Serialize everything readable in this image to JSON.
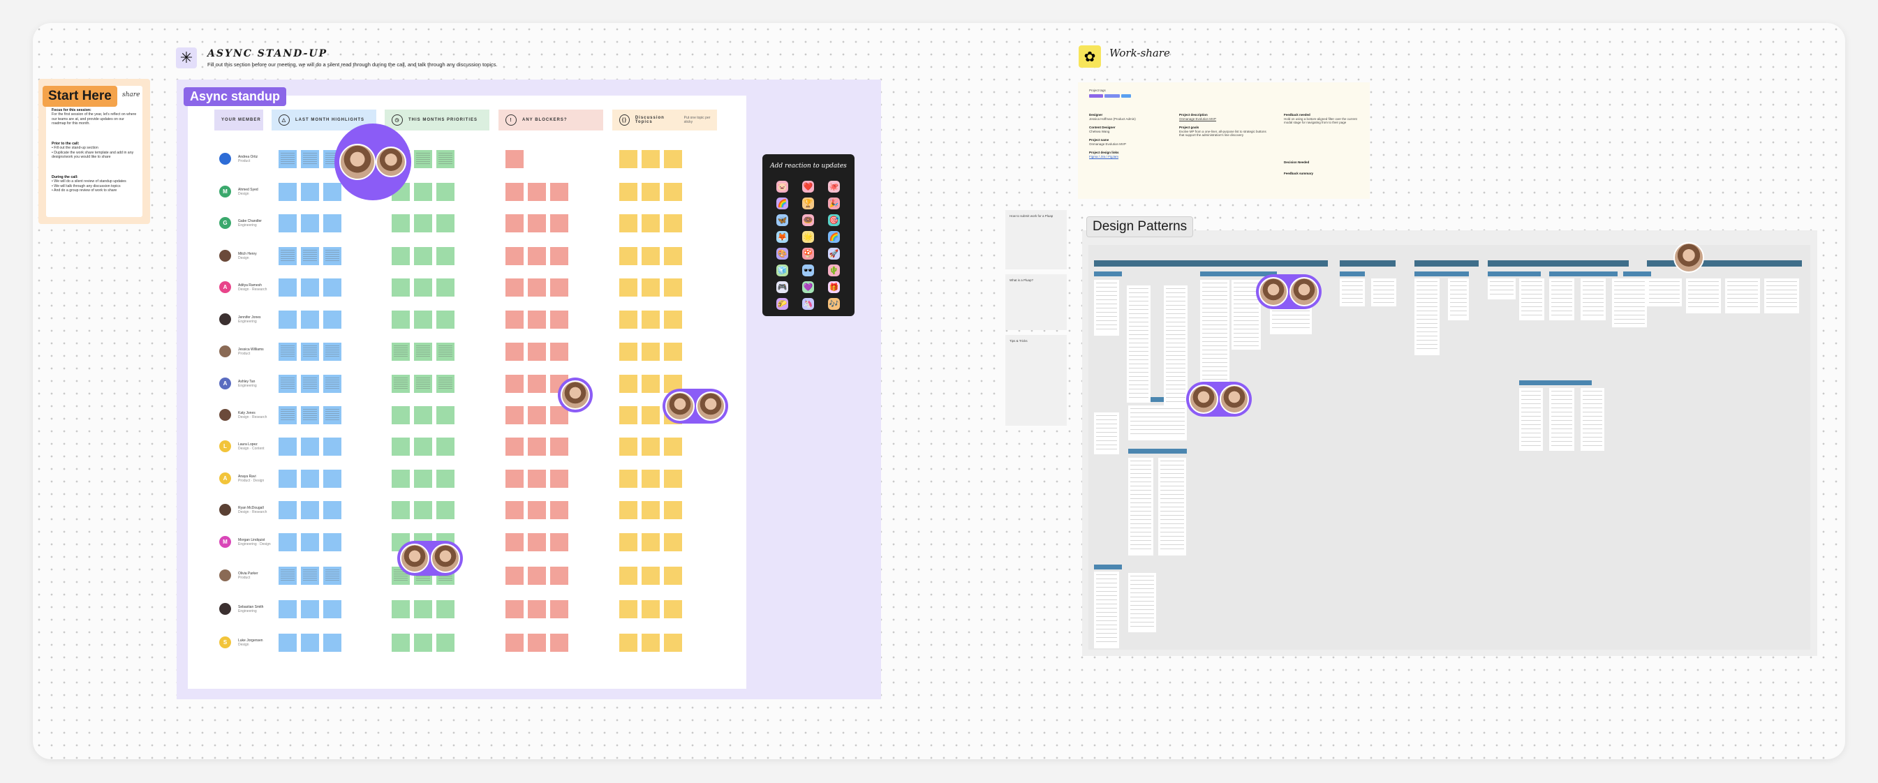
{
  "start_here": {
    "label": "Start Here",
    "share": "share",
    "focus_heading": "Focus for this session:",
    "focus_text": "For the first session of the year, let's reflect on where our teams are at, and provide updates on our roadmap for this month.",
    "prior_heading": "Prior to the call:",
    "prior_items": [
      "Fill out the stand-up section",
      "Duplicate the work share template and add in any designs/work you would like to share"
    ],
    "during_heading": "During the call:",
    "during_items": [
      "We will do a silent review of standup updates",
      "We will talk through any discussion topics",
      "And do a group review of work to share"
    ]
  },
  "async": {
    "title": "ASYNC STAND-UP",
    "subtitle": "Fill out this section before our meeting, we will do a silent read through during the call, and talk through any discussion topics.",
    "section_label": "Async standup",
    "columns": [
      {
        "icon": "",
        "label": "YOUR MEMBER",
        "color": "#e2ddf7"
      },
      {
        "icon": "△",
        "label": "LAST MONTH HIGHLIGHTS",
        "color": "#d6e9fb"
      },
      {
        "icon": "◷",
        "label": "THIS MONTHS PRIORITIES",
        "color": "#dbefdf"
      },
      {
        "icon": "!",
        "label": "ANY BLOCKERS?",
        "color": "#f8ded8"
      },
      {
        "icon": "{}",
        "label": "Discussion Topics",
        "note": "Put one topic per sticky",
        "color": "#fdecd5"
      }
    ],
    "members": [
      {
        "name": "Andrea Ortiz",
        "role": "Product",
        "initial": "",
        "color": "#2d6cd6"
      },
      {
        "name": "Ahmed Syed",
        "role": "Design",
        "initial": "M",
        "color": "#3aa86c"
      },
      {
        "name": "Gabe Chandler",
        "role": "Engineering",
        "initial": "G",
        "color": "#3aa86c"
      },
      {
        "name": "Mitch Henry",
        "role": "Design",
        "initial": "",
        "color": "#6b4a3a"
      },
      {
        "name": "Aditya Ramesh",
        "role": "Design · Research",
        "initial": "A",
        "color": "#e8448a"
      },
      {
        "name": "Jennifer Jones",
        "role": "Engineering",
        "initial": "",
        "color": "#3b3030"
      },
      {
        "name": "Jessica Williams",
        "role": "Product",
        "initial": "",
        "color": "#8a6a55"
      },
      {
        "name": "Ashley Tan",
        "role": "Engineering",
        "initial": "A",
        "color": "#5a6cc0"
      },
      {
        "name": "Katy Jones",
        "role": "Design · Research",
        "initial": "",
        "color": "#6b4a3a"
      },
      {
        "name": "Laura Lopez",
        "role": "Design · Content",
        "initial": "L",
        "color": "#f2c43a"
      },
      {
        "name": "Anaya Ravi",
        "role": "Product · Design",
        "initial": "A",
        "color": "#f2c43a"
      },
      {
        "name": "Ryan McDougall",
        "role": "Design · Research",
        "initial": "",
        "color": "#5a4033"
      },
      {
        "name": "Morgan Lindquist",
        "role": "Engineering · Design",
        "initial": "M",
        "color": "#d946b8"
      },
      {
        "name": "Olivia Parker",
        "role": "Product",
        "initial": "",
        "color": "#8a6a55"
      },
      {
        "name": "Sebastian Smith",
        "role": "Engineering",
        "initial": "",
        "color": "#3b3030"
      },
      {
        "name": "Luke Jorgensen",
        "role": "Design",
        "initial": "S",
        "color": "#f2c43a"
      }
    ],
    "sticky_colors": {
      "highlights": "#8ec5f5",
      "priorities": "#9edca8",
      "blockers": "#f2a39a",
      "topics": "#f8d26a"
    }
  },
  "reactions": {
    "title": "Add reaction to updates",
    "stickers": [
      "🐷",
      "❤️",
      "🐙",
      "🌈",
      "🏆",
      "🎉",
      "🦋",
      "🍩",
      "🎯",
      "🦊",
      "🌟",
      "🌈",
      "🎨",
      "🍄",
      "🚀",
      "🧊",
      "🕶️",
      "🌵",
      "🎮",
      "💜",
      "🎁",
      "🌮",
      "🦄",
      "🎶"
    ]
  },
  "workshare": {
    "title": "Work-share",
    "tags_label": "Project tags",
    "fields": [
      {
        "label": "Designer",
        "value": "Jessica Hoffman (Product Admin)"
      },
      {
        "label": "Content Designer",
        "value": "Chelsea Wang"
      },
      {
        "label": "Project name",
        "value": "Onmanage Evolution MVP"
      },
      {
        "label": "Project design links",
        "value": "Figma / Jira / FigJam"
      },
      {
        "label": "Project description",
        "value": "Onmanage Evolution MVP"
      },
      {
        "label": "Project goals",
        "value": "Evolve MP from a one-liner, all-purpose list to strategic buttons that support the administration's line discovery"
      },
      {
        "label": "Feedback needed",
        "value": "Hold on using a bottom-aligned filter over the current modal stage for navigating from to their page"
      },
      {
        "label": "Decision Needed",
        "value": ""
      },
      {
        "label": "Feedback summary",
        "value": ""
      }
    ]
  },
  "design_patterns": {
    "label": "Design Patterns",
    "sidebar_notes": [
      "How to submit work for a Pluap",
      "What is a Pluap?",
      "Tips & Tricks"
    ]
  }
}
